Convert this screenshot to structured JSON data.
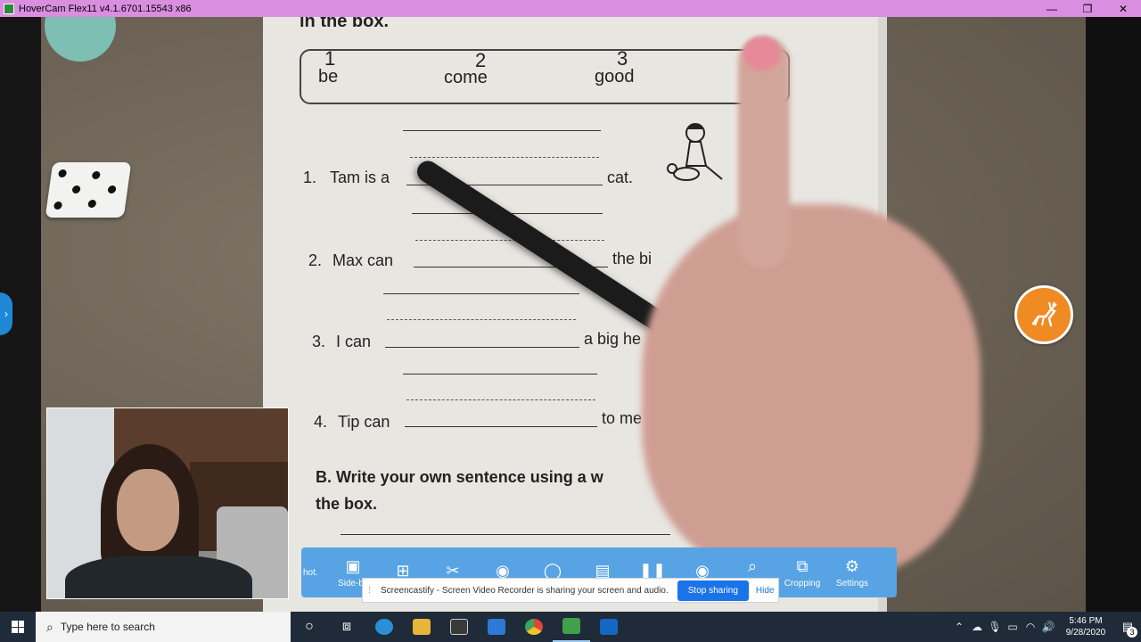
{
  "window": {
    "title": "HoverCam Flex11 v4.1.6701.15543 x86",
    "controls": {
      "minimize": "—",
      "restore": "❐",
      "close": "✕"
    }
  },
  "worksheet": {
    "heading_fragment": "in the box.",
    "word_box": [
      {
        "number": "1",
        "word": "be"
      },
      {
        "number": "2",
        "word": "come"
      },
      {
        "number": "3",
        "word": "good"
      }
    ],
    "questions": [
      {
        "label": "1.",
        "before": "Tam is a",
        "after": "cat."
      },
      {
        "label": "2.",
        "before": "Max can",
        "after": "the bi"
      },
      {
        "label": "3.",
        "before": "I can",
        "after": "a big he"
      },
      {
        "label": "4.",
        "before": "Tip can",
        "after": "to me"
      }
    ],
    "section_b_line1": "B. Write your own sentence using a w",
    "section_b_line2": "the box."
  },
  "side_tab": {
    "glyph": "›"
  },
  "toolbar": {
    "edge_left": "hot.",
    "items": [
      {
        "name": "side-by-side",
        "glyph": "▣",
        "label": "Side-by"
      },
      {
        "name": "windows",
        "glyph": "⊞",
        "label": ""
      },
      {
        "name": "tools",
        "glyph": "✂",
        "label": ""
      },
      {
        "name": "capture",
        "glyph": "◉",
        "label": ""
      },
      {
        "name": "record",
        "glyph": "◯",
        "label": ""
      },
      {
        "name": "annotate",
        "glyph": "▤",
        "label": ""
      },
      {
        "name": "pause",
        "glyph": "❚❚",
        "label": ""
      },
      {
        "name": "view",
        "glyph": "◉",
        "label": ""
      },
      {
        "name": "zoom",
        "glyph": "⌕",
        "label": "om"
      },
      {
        "name": "cropping",
        "glyph": "⧉",
        "label": "Cropping"
      },
      {
        "name": "settings",
        "glyph": "⚙",
        "label": "Settings"
      }
    ]
  },
  "share_notice": {
    "grip": "⁞",
    "message": "Screencastify - Screen Video Recorder is sharing your screen and audio.",
    "stop_label": "Stop sharing",
    "hide_label": "Hide"
  },
  "taskbar": {
    "search_placeholder": "Type here to search",
    "cortana_glyph": "○",
    "taskview_glyph": "⧈",
    "apps": [
      {
        "name": "edge",
        "color": "#2b8fd8"
      },
      {
        "name": "file-explorer",
        "color": "#e8b43a"
      },
      {
        "name": "store",
        "color": "#3a3a3a"
      },
      {
        "name": "mail",
        "color": "#2c79d8"
      },
      {
        "name": "chrome",
        "color": "#e0453a"
      },
      {
        "name": "hovercam",
        "color": "#3fa14a"
      },
      {
        "name": "outlook",
        "color": "#1467c2"
      }
    ],
    "tray": [
      "⌃",
      "☁",
      "🎙",
      "▭",
      "◠",
      "🔊"
    ],
    "time": "5:46 PM",
    "date": "9/28/2020",
    "notification_count": "3"
  }
}
